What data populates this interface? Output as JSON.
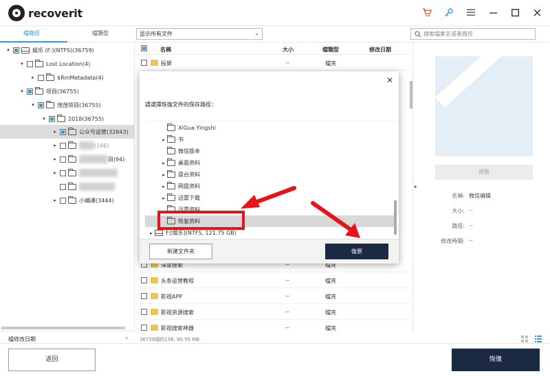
{
  "app": {
    "name": "recoverit",
    "icons": [
      "cart-icon",
      "key-icon",
      "menu-icon",
      "minimize-icon",
      "maximize-icon",
      "close-icon"
    ]
  },
  "toolbar": {
    "tab_path": "檔路徑",
    "tab_type": "檔類型",
    "filter_value": "显示所有文件",
    "search_placeholder": "搜索檔案名或者路徑"
  },
  "tree": {
    "nodes": [
      {
        "label": "娱乐 (F:)(NTFS)(36759)"
      },
      {
        "label": "Lost Location(4)"
      },
      {
        "label": "$RmMetadata(4)"
      },
      {
        "label": "项目(36755)"
      },
      {
        "label": "茂茂项目(36755)"
      },
      {
        "label": "2018(36755)"
      },
      {
        "label": "公众号运营(32843)"
      },
      {
        "label": "(166)"
      },
      {
        "label": "目(94)"
      },
      {
        "label": ""
      },
      {
        "label": ""
      },
      {
        "label": "小编课(3444)"
      }
    ],
    "footer": "檔修改日期"
  },
  "list": {
    "headers": {
      "name": "名稱",
      "size": "大小",
      "type": "檔類型",
      "modified": "修改日期"
    },
    "rows_top": [
      {
        "name": "投屏",
        "size": "--",
        "type": "檔夾"
      }
    ],
    "rows_bottom": [
      {
        "name": "深度搜索",
        "size": "--",
        "type": "檔夾"
      },
      {
        "name": "头条运营教程",
        "size": "--",
        "type": "檔夾"
      },
      {
        "name": "影视APP",
        "size": "--",
        "type": "檔夾"
      },
      {
        "name": "影视资源搜索",
        "size": "--",
        "type": "檔夾"
      },
      {
        "name": "影视搜索神器",
        "size": "--",
        "type": "檔夾"
      }
    ],
    "status": "36759項的156, 95.55 MB"
  },
  "preview": {
    "button": "預覽",
    "meta": [
      {
        "key": "名稱:",
        "value": "微信编辑"
      },
      {
        "key": "大小:",
        "value": "--"
      },
      {
        "key": "路徑:",
        "value": "--"
      },
      {
        "key": "修改時間:",
        "value": "--"
      }
    ]
  },
  "dialog": {
    "label": "請選擇恢復文件的保存路徑：",
    "nodes": [
      {
        "label": "XiGua Yingshi"
      },
      {
        "label": "书"
      },
      {
        "label": "微信版本"
      },
      {
        "label": "桌面资料"
      },
      {
        "label": "盘台资料"
      },
      {
        "label": "网盘资料"
      },
      {
        "label": "迅雷下载"
      },
      {
        "label": "迅雷资料"
      },
      {
        "label": "恢复资料"
      },
      {
        "label": "F:[娱乐](NTFS, 121.75  GB)"
      }
    ],
    "new_folder": "新建文件夹",
    "restore": "復原"
  },
  "bottom": {
    "back": "返回",
    "recover": "恢復"
  },
  "annotation_color": "#e8131a"
}
